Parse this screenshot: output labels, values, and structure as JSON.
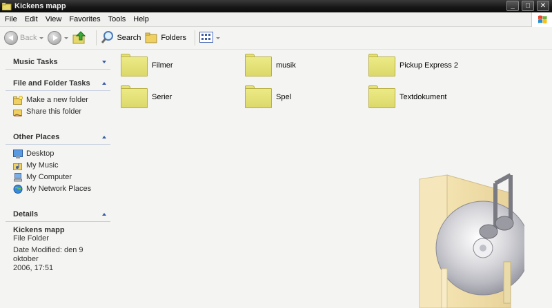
{
  "window": {
    "title": "Kickens mapp"
  },
  "menu": [
    "File",
    "Edit",
    "View",
    "Favorites",
    "Tools",
    "Help"
  ],
  "toolbar": {
    "back": "Back",
    "search": "Search",
    "folders": "Folders"
  },
  "tasks": {
    "music_tasks": "Music Tasks",
    "file_folder_tasks": {
      "title": "File and Folder Tasks",
      "items": [
        "Make a new folder",
        "Share this folder"
      ]
    },
    "other_places": {
      "title": "Other Places",
      "items": [
        "Desktop",
        "My Music",
        "My Computer",
        "My Network Places"
      ]
    },
    "details": {
      "title": "Details",
      "name": "Kickens mapp",
      "type": "File Folder",
      "modified_1": "Date Modified: den 9 oktober",
      "modified_2": "2006, 17:51"
    }
  },
  "folders": [
    "Filmer",
    "musik",
    "Pickup Express 2",
    "Serier",
    "Spel",
    "Textdokument"
  ],
  "colors": {
    "folder": "#e6e07a",
    "link": "#2b2b2b",
    "chevron": "#3a5aa8"
  }
}
